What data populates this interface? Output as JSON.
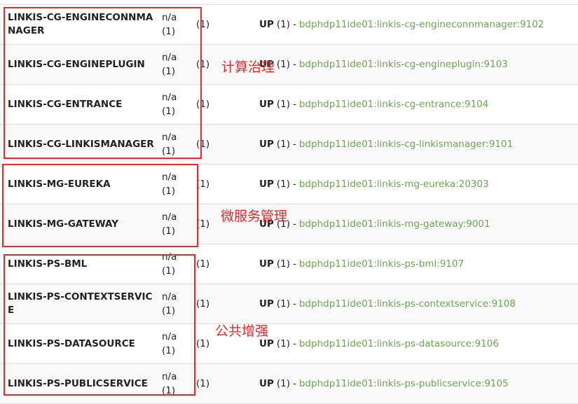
{
  "rows": [
    {
      "app": "LINKIS-CG-ENGINECONNMANAGER",
      "ami": "n/a",
      "ami_count": "(1)",
      "zones": "(1)",
      "status": "UP",
      "status_count": "(1)",
      "instance": "bdphdp11ide01:linkis-cg-engineconnmanager:9102"
    },
    {
      "app": "LINKIS-CG-ENGINEPLUGIN",
      "ami": "n/a",
      "ami_count": "(1)",
      "zones": "(1)",
      "status": "UP",
      "status_count": "(1)",
      "instance": "bdphdp11ide01:linkis-cg-engineplugin:9103"
    },
    {
      "app": "LINKIS-CG-ENTRANCE",
      "ami": "n/a",
      "ami_count": "(1)",
      "zones": "(1)",
      "status": "UP",
      "status_count": "(1)",
      "instance": "bdphdp11ide01:linkis-cg-entrance:9104"
    },
    {
      "app": "LINKIS-CG-LINKISMANAGER",
      "ami": "n/a",
      "ami_count": "(1)",
      "zones": "(1)",
      "status": "UP",
      "status_count": "(1)",
      "instance": "bdphdp11ide01:linkis-cg-linkismanager:9101"
    },
    {
      "app": "LINKIS-MG-EUREKA",
      "ami": "n/a",
      "ami_count": "(1)",
      "zones": "(1)",
      "status": "UP",
      "status_count": "(1)",
      "instance": "bdphdp11ide01:linkis-mg-eureka:20303"
    },
    {
      "app": "LINKIS-MG-GATEWAY",
      "ami": "n/a",
      "ami_count": "(1)",
      "zones": "(1)",
      "status": "UP",
      "status_count": "(1)",
      "instance": "bdphdp11ide01:linkis-mg-gateway:9001"
    },
    {
      "app": "LINKIS-PS-BML",
      "ami": "n/a",
      "ami_count": "(1)",
      "zones": "(1)",
      "status": "UP",
      "status_count": "(1)",
      "instance": "bdphdp11ide01:linkis-ps-bml:9107"
    },
    {
      "app": "LINKIS-PS-CONTEXTSERVICE",
      "ami": "n/a",
      "ami_count": "(1)",
      "zones": "(1)",
      "status": "UP",
      "status_count": "(1)",
      "instance": "bdphdp11ide01:linkis-ps-contextservice:9108"
    },
    {
      "app": "LINKIS-PS-DATASOURCE",
      "ami": "n/a",
      "ami_count": "(1)",
      "zones": "(1)",
      "status": "UP",
      "status_count": "(1)",
      "instance": "bdphdp11ide01:linkis-ps-datasource:9106"
    },
    {
      "app": "LINKIS-PS-PUBLICSERVICE",
      "ami": "n/a",
      "ami_count": "(1)",
      "zones": "(1)",
      "status": "UP",
      "status_count": "(1)",
      "instance": "bdphdp11ide01:linkis-ps-publicservice:9105"
    }
  ],
  "status_separator": "-",
  "annotations": [
    {
      "label": "计算治理",
      "rows": [
        0,
        3
      ]
    },
    {
      "label": "微服务管理",
      "rows": [
        4,
        5
      ]
    },
    {
      "label": "公共增强",
      "rows": [
        6,
        9
      ]
    }
  ],
  "colors": {
    "annotation": "#e8282b",
    "instance_link": "#6aa84f",
    "row_alt": "#f9f9f9",
    "divider": "#dddddd"
  }
}
